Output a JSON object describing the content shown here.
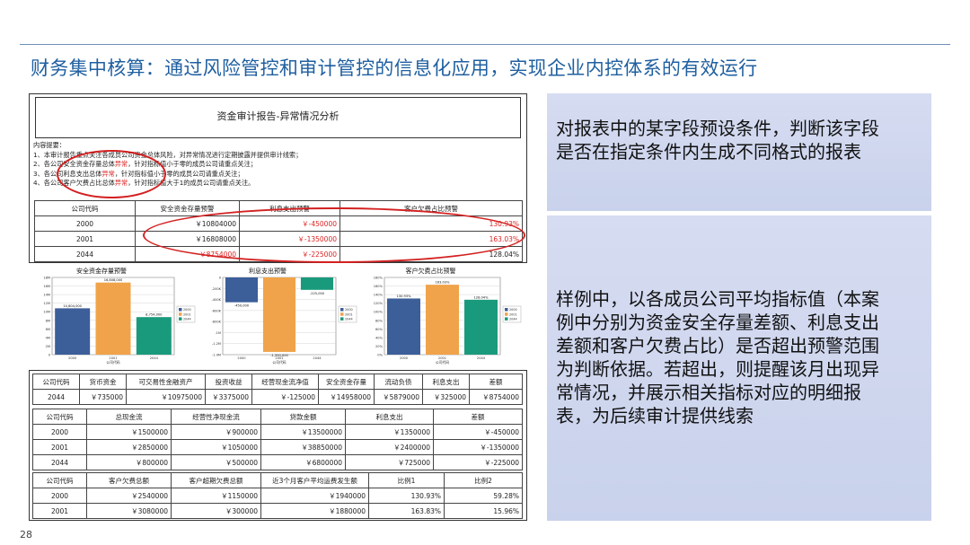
{
  "slide": {
    "title": "财务集中核算：通过风险管控和审计管控的信息化应用，实现企业内控体系的有效运行",
    "page_number": "28"
  },
  "panel_top": {
    "text": "对报表中的某字段预设条件，判断该字段是否在指定条件内生成不同格式的报表"
  },
  "panel_bottom": {
    "text": "样例中，以各成员公司平均指标值（本案例中分别为资金安全存量差额、利息支出差额和客户欠费占比）是否超出预警范围为判断依据。若超出，则提醒该月出现异常情况，并展示相关指标对应的明细报表，为后续审计提供线索"
  },
  "report": {
    "title": "资金审计报告-异常情况分析",
    "notes_heading": "内容提要：",
    "notes": [
      {
        "pre": "1、本审计报告重点关注各成员公司资金总体风险，对异常情况进行定期披露并提供审计线索；",
        "red": "",
        "post": ""
      },
      {
        "pre": "2、各公司安全资金存量总体",
        "red": "异常",
        "post": "，针对指标值小于零的成员公司请重点关注；"
      },
      {
        "pre": "3、各公司利息支出总体",
        "red": "异常",
        "post": "，针对指标值小于零的成员公司请重点关注；"
      },
      {
        "pre": "4、各公司客户欠费占比总体",
        "red": "异常",
        "post": "，针对指标值大于1的成员公司请重点关注。"
      }
    ],
    "table": {
      "headers": [
        "公司代码",
        "安全资金存量预警",
        "利息支出预警",
        "客户欠费占比预警"
      ],
      "rows": [
        [
          "2000",
          "￥10804000",
          "￥-450000",
          "130.93%"
        ],
        [
          "2001",
          "￥16808000",
          "￥-1350000",
          "163.03%"
        ],
        [
          "2044",
          "￥8754000",
          "￥-225000",
          "128.04%"
        ]
      ],
      "red_cells": [
        [
          0,
          2
        ],
        [
          0,
          3
        ],
        [
          1,
          2
        ],
        [
          1,
          3
        ],
        [
          2,
          1
        ],
        [
          2,
          2
        ]
      ]
    }
  },
  "charts_text": {
    "legend": [
      "2000",
      "2001",
      "2044"
    ],
    "xlabel": "公司代码"
  },
  "chart_data": [
    {
      "type": "bar",
      "title": "安全资金存量预警",
      "categories": [
        "2000",
        "2001",
        "2044"
      ],
      "values": [
        10804000,
        16808000,
        8754000
      ],
      "data_labels": [
        "10,804,000",
        "16,808,000",
        "8,754,000"
      ],
      "ylim": [
        0,
        18000000
      ],
      "yticks": [
        "0",
        "2M",
        "4M",
        "6M",
        "8M",
        "10M",
        "12M",
        "14M",
        "16M",
        "18M"
      ],
      "xlabel": "公司代码",
      "colors": [
        "#3c5e99",
        "#f0a34a",
        "#1a9a7c"
      ],
      "legend": [
        "2000",
        "2001",
        "2044"
      ]
    },
    {
      "type": "bar",
      "title": "利息支出预警",
      "categories": [
        "2000",
        "2001",
        "2044"
      ],
      "values": [
        -450000,
        -1350000,
        -225000
      ],
      "data_labels": [
        "-450,000",
        "-1,350,000",
        "-225,000"
      ],
      "ylim": [
        -1400000,
        0
      ],
      "yticks": [
        "0",
        "-200K",
        "-400K",
        "-600K",
        "-800K",
        "-1M",
        "-1.2M",
        "-1.4M"
      ],
      "xlabel": "公司代码",
      "colors": [
        "#3c5e99",
        "#f0a34a",
        "#1a9a7c"
      ],
      "legend": [
        "2000",
        "2001",
        "2044"
      ]
    },
    {
      "type": "bar",
      "title": "客户欠费占比预警",
      "categories": [
        "2000",
        "2001",
        "2044"
      ],
      "values": [
        130.93,
        163.03,
        128.04
      ],
      "data_labels": [
        "130.93%",
        "163.03%",
        "128.04%"
      ],
      "ylim": [
        0,
        180
      ],
      "yticks": [
        "0%",
        "20%",
        "40%",
        "60%",
        "80%",
        "100%",
        "120%",
        "140%",
        "160%",
        "180%"
      ],
      "xlabel": "公司代码",
      "colors": [
        "#3c5e99",
        "#f0a34a",
        "#1a9a7c"
      ],
      "legend": [
        "2000",
        "2001",
        "2044"
      ]
    }
  ],
  "tables": {
    "t1": {
      "headers": [
        "公司代码",
        "货币资金",
        "可交易性金融资产",
        "投资收益",
        "经营现金流净值",
        "安全资金存量",
        "流动负债",
        "利息支出",
        "差额"
      ],
      "rows": [
        [
          "2044",
          "￥735000",
          "￥10975000",
          "￥3375000",
          "￥-125000",
          "￥14958000",
          "￥5879000",
          "￥325000",
          "￥8754000"
        ]
      ]
    },
    "t2": {
      "headers": [
        "公司代码",
        "总现金流",
        "经营性净现金流",
        "贷款金额",
        "利息支出",
        "差额"
      ],
      "rows": [
        [
          "2000",
          "￥1500000",
          "￥900000",
          "￥13500000",
          "￥1350000",
          "￥-450000"
        ],
        [
          "2001",
          "￥2850000",
          "￥1050000",
          "￥38850000",
          "￥2400000",
          "￥-1350000"
        ],
        [
          "2044",
          "￥800000",
          "￥500000",
          "￥6800000",
          "￥725000",
          "￥-225000"
        ]
      ]
    },
    "t3": {
      "headers": [
        "公司代码",
        "客户欠费总额",
        "客户超期欠费总额",
        "近3个月客户平均运费发生额",
        "比例1",
        "比例2"
      ],
      "rows": [
        [
          "2000",
          "￥2540000",
          "￥1150000",
          "￥1940000",
          "130.93%",
          "59.28%"
        ],
        [
          "2001",
          "￥3080000",
          "￥300000",
          "￥1880000",
          "163.83%",
          "15.96%"
        ]
      ]
    }
  }
}
